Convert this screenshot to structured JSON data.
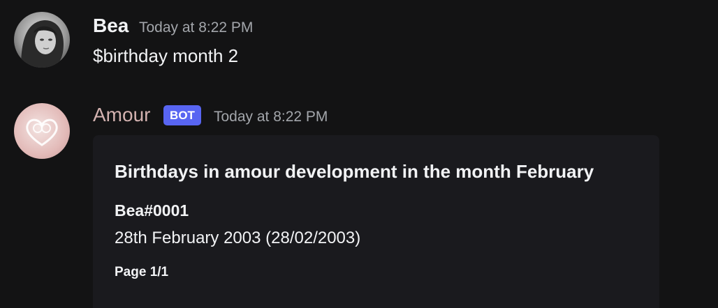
{
  "messages": [
    {
      "username": "Bea",
      "timestamp": "Today at 8:22 PM",
      "content": "$birthday month 2"
    },
    {
      "username": "Amour",
      "bot_tag": "BOT",
      "timestamp": "Today at 8:22 PM",
      "embed": {
        "title": "Birthdays in amour development in the month February",
        "field_name": "Bea#0001",
        "field_value": "28th February 2003 (28/02/2003)",
        "footer": "Page 1/1"
      }
    }
  ],
  "colors": {
    "background": "#131314",
    "embed_background": "#1a1a1e",
    "bot_tag": "#5865f2",
    "bot_username": "#d3b2b0",
    "timestamp": "#a3a6ab"
  },
  "icons": [
    "user-avatar-bea",
    "bot-avatar-amour-heart"
  ]
}
